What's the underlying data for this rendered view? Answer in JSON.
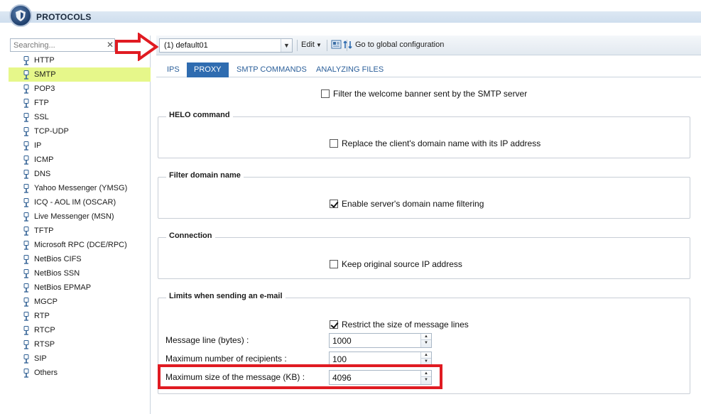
{
  "header": {
    "title": "PROTOCOLS"
  },
  "sidebar": {
    "search_placeholder": "Searching...",
    "clear_symbol": "✕",
    "items": [
      {
        "label": "HTTP"
      },
      {
        "label": "SMTP",
        "selected": true
      },
      {
        "label": "POP3"
      },
      {
        "label": "FTP"
      },
      {
        "label": "SSL"
      },
      {
        "label": "TCP-UDP"
      },
      {
        "label": "IP"
      },
      {
        "label": "ICMP"
      },
      {
        "label": "DNS"
      },
      {
        "label": "Yahoo Messenger (YMSG)"
      },
      {
        "label": "ICQ - AOL IM (OSCAR)"
      },
      {
        "label": "Live Messenger (MSN)"
      },
      {
        "label": "TFTP"
      },
      {
        "label": "Microsoft RPC (DCE/RPC)"
      },
      {
        "label": "NetBios CIFS"
      },
      {
        "label": "NetBios SSN"
      },
      {
        "label": "NetBios EPMAP"
      },
      {
        "label": "MGCP"
      },
      {
        "label": "RTP"
      },
      {
        "label": "RTCP"
      },
      {
        "label": "RTSP"
      },
      {
        "label": "SIP"
      },
      {
        "label": "Others"
      }
    ],
    "selected_color": "#e6f78a"
  },
  "toolbar": {
    "profile_value": "(1) default01",
    "edit_label": "Edit",
    "global_label": "Go to global configuration"
  },
  "tabs": [
    {
      "label": "IPS"
    },
    {
      "label": "PROXY",
      "active": true
    },
    {
      "label": "SMTP COMMANDS"
    },
    {
      "label": "ANALYZING FILES"
    }
  ],
  "content": {
    "welcome_banner": {
      "label": "Filter the welcome banner sent by the SMTP server",
      "checked": false
    },
    "helo": {
      "legend": "HELO command",
      "replace_domain": {
        "label": "Replace the client's domain name with its IP address",
        "checked": false
      }
    },
    "filter_domain": {
      "legend": "Filter domain name",
      "enable_filtering": {
        "label": "Enable server's domain name filtering",
        "checked": true
      }
    },
    "connection": {
      "legend": "Connection",
      "keep_source": {
        "label": "Keep original source IP address",
        "checked": false
      }
    },
    "limits": {
      "legend": "Limits when sending an e-mail",
      "restrict_lines": {
        "label": "Restrict the size of message lines",
        "checked": true
      },
      "message_line": {
        "label": "Message line (bytes) :",
        "value": "1000"
      },
      "max_recipients": {
        "label": "Maximum number of recipients :",
        "value": "100"
      },
      "max_size": {
        "label": "Maximum size of the message (KB) :",
        "value": "4096"
      }
    }
  },
  "colors": {
    "accent": "#2f6cb0",
    "annotation_red": "#e01b22"
  }
}
